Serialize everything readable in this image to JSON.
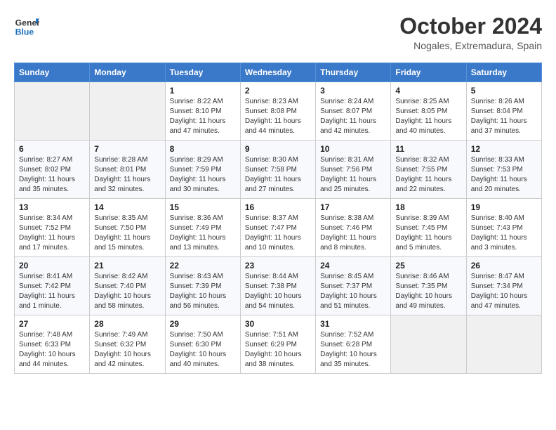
{
  "header": {
    "logo_line1": "General",
    "logo_line2": "Blue",
    "month": "October 2024",
    "location": "Nogales, Extremadura, Spain"
  },
  "weekdays": [
    "Sunday",
    "Monday",
    "Tuesday",
    "Wednesday",
    "Thursday",
    "Friday",
    "Saturday"
  ],
  "weeks": [
    [
      {
        "day": "",
        "info": ""
      },
      {
        "day": "",
        "info": ""
      },
      {
        "day": "1",
        "info": "Sunrise: 8:22 AM\nSunset: 8:10 PM\nDaylight: 11 hours and 47 minutes."
      },
      {
        "day": "2",
        "info": "Sunrise: 8:23 AM\nSunset: 8:08 PM\nDaylight: 11 hours and 44 minutes."
      },
      {
        "day": "3",
        "info": "Sunrise: 8:24 AM\nSunset: 8:07 PM\nDaylight: 11 hours and 42 minutes."
      },
      {
        "day": "4",
        "info": "Sunrise: 8:25 AM\nSunset: 8:05 PM\nDaylight: 11 hours and 40 minutes."
      },
      {
        "day": "5",
        "info": "Sunrise: 8:26 AM\nSunset: 8:04 PM\nDaylight: 11 hours and 37 minutes."
      }
    ],
    [
      {
        "day": "6",
        "info": "Sunrise: 8:27 AM\nSunset: 8:02 PM\nDaylight: 11 hours and 35 minutes."
      },
      {
        "day": "7",
        "info": "Sunrise: 8:28 AM\nSunset: 8:01 PM\nDaylight: 11 hours and 32 minutes."
      },
      {
        "day": "8",
        "info": "Sunrise: 8:29 AM\nSunset: 7:59 PM\nDaylight: 11 hours and 30 minutes."
      },
      {
        "day": "9",
        "info": "Sunrise: 8:30 AM\nSunset: 7:58 PM\nDaylight: 11 hours and 27 minutes."
      },
      {
        "day": "10",
        "info": "Sunrise: 8:31 AM\nSunset: 7:56 PM\nDaylight: 11 hours and 25 minutes."
      },
      {
        "day": "11",
        "info": "Sunrise: 8:32 AM\nSunset: 7:55 PM\nDaylight: 11 hours and 22 minutes."
      },
      {
        "day": "12",
        "info": "Sunrise: 8:33 AM\nSunset: 7:53 PM\nDaylight: 11 hours and 20 minutes."
      }
    ],
    [
      {
        "day": "13",
        "info": "Sunrise: 8:34 AM\nSunset: 7:52 PM\nDaylight: 11 hours and 17 minutes."
      },
      {
        "day": "14",
        "info": "Sunrise: 8:35 AM\nSunset: 7:50 PM\nDaylight: 11 hours and 15 minutes."
      },
      {
        "day": "15",
        "info": "Sunrise: 8:36 AM\nSunset: 7:49 PM\nDaylight: 11 hours and 13 minutes."
      },
      {
        "day": "16",
        "info": "Sunrise: 8:37 AM\nSunset: 7:47 PM\nDaylight: 11 hours and 10 minutes."
      },
      {
        "day": "17",
        "info": "Sunrise: 8:38 AM\nSunset: 7:46 PM\nDaylight: 11 hours and 8 minutes."
      },
      {
        "day": "18",
        "info": "Sunrise: 8:39 AM\nSunset: 7:45 PM\nDaylight: 11 hours and 5 minutes."
      },
      {
        "day": "19",
        "info": "Sunrise: 8:40 AM\nSunset: 7:43 PM\nDaylight: 11 hours and 3 minutes."
      }
    ],
    [
      {
        "day": "20",
        "info": "Sunrise: 8:41 AM\nSunset: 7:42 PM\nDaylight: 11 hours and 1 minute."
      },
      {
        "day": "21",
        "info": "Sunrise: 8:42 AM\nSunset: 7:40 PM\nDaylight: 10 hours and 58 minutes."
      },
      {
        "day": "22",
        "info": "Sunrise: 8:43 AM\nSunset: 7:39 PM\nDaylight: 10 hours and 56 minutes."
      },
      {
        "day": "23",
        "info": "Sunrise: 8:44 AM\nSunset: 7:38 PM\nDaylight: 10 hours and 54 minutes."
      },
      {
        "day": "24",
        "info": "Sunrise: 8:45 AM\nSunset: 7:37 PM\nDaylight: 10 hours and 51 minutes."
      },
      {
        "day": "25",
        "info": "Sunrise: 8:46 AM\nSunset: 7:35 PM\nDaylight: 10 hours and 49 minutes."
      },
      {
        "day": "26",
        "info": "Sunrise: 8:47 AM\nSunset: 7:34 PM\nDaylight: 10 hours and 47 minutes."
      }
    ],
    [
      {
        "day": "27",
        "info": "Sunrise: 7:48 AM\nSunset: 6:33 PM\nDaylight: 10 hours and 44 minutes."
      },
      {
        "day": "28",
        "info": "Sunrise: 7:49 AM\nSunset: 6:32 PM\nDaylight: 10 hours and 42 minutes."
      },
      {
        "day": "29",
        "info": "Sunrise: 7:50 AM\nSunset: 6:30 PM\nDaylight: 10 hours and 40 minutes."
      },
      {
        "day": "30",
        "info": "Sunrise: 7:51 AM\nSunset: 6:29 PM\nDaylight: 10 hours and 38 minutes."
      },
      {
        "day": "31",
        "info": "Sunrise: 7:52 AM\nSunset: 6:28 PM\nDaylight: 10 hours and 35 minutes."
      },
      {
        "day": "",
        "info": ""
      },
      {
        "day": "",
        "info": ""
      }
    ]
  ]
}
